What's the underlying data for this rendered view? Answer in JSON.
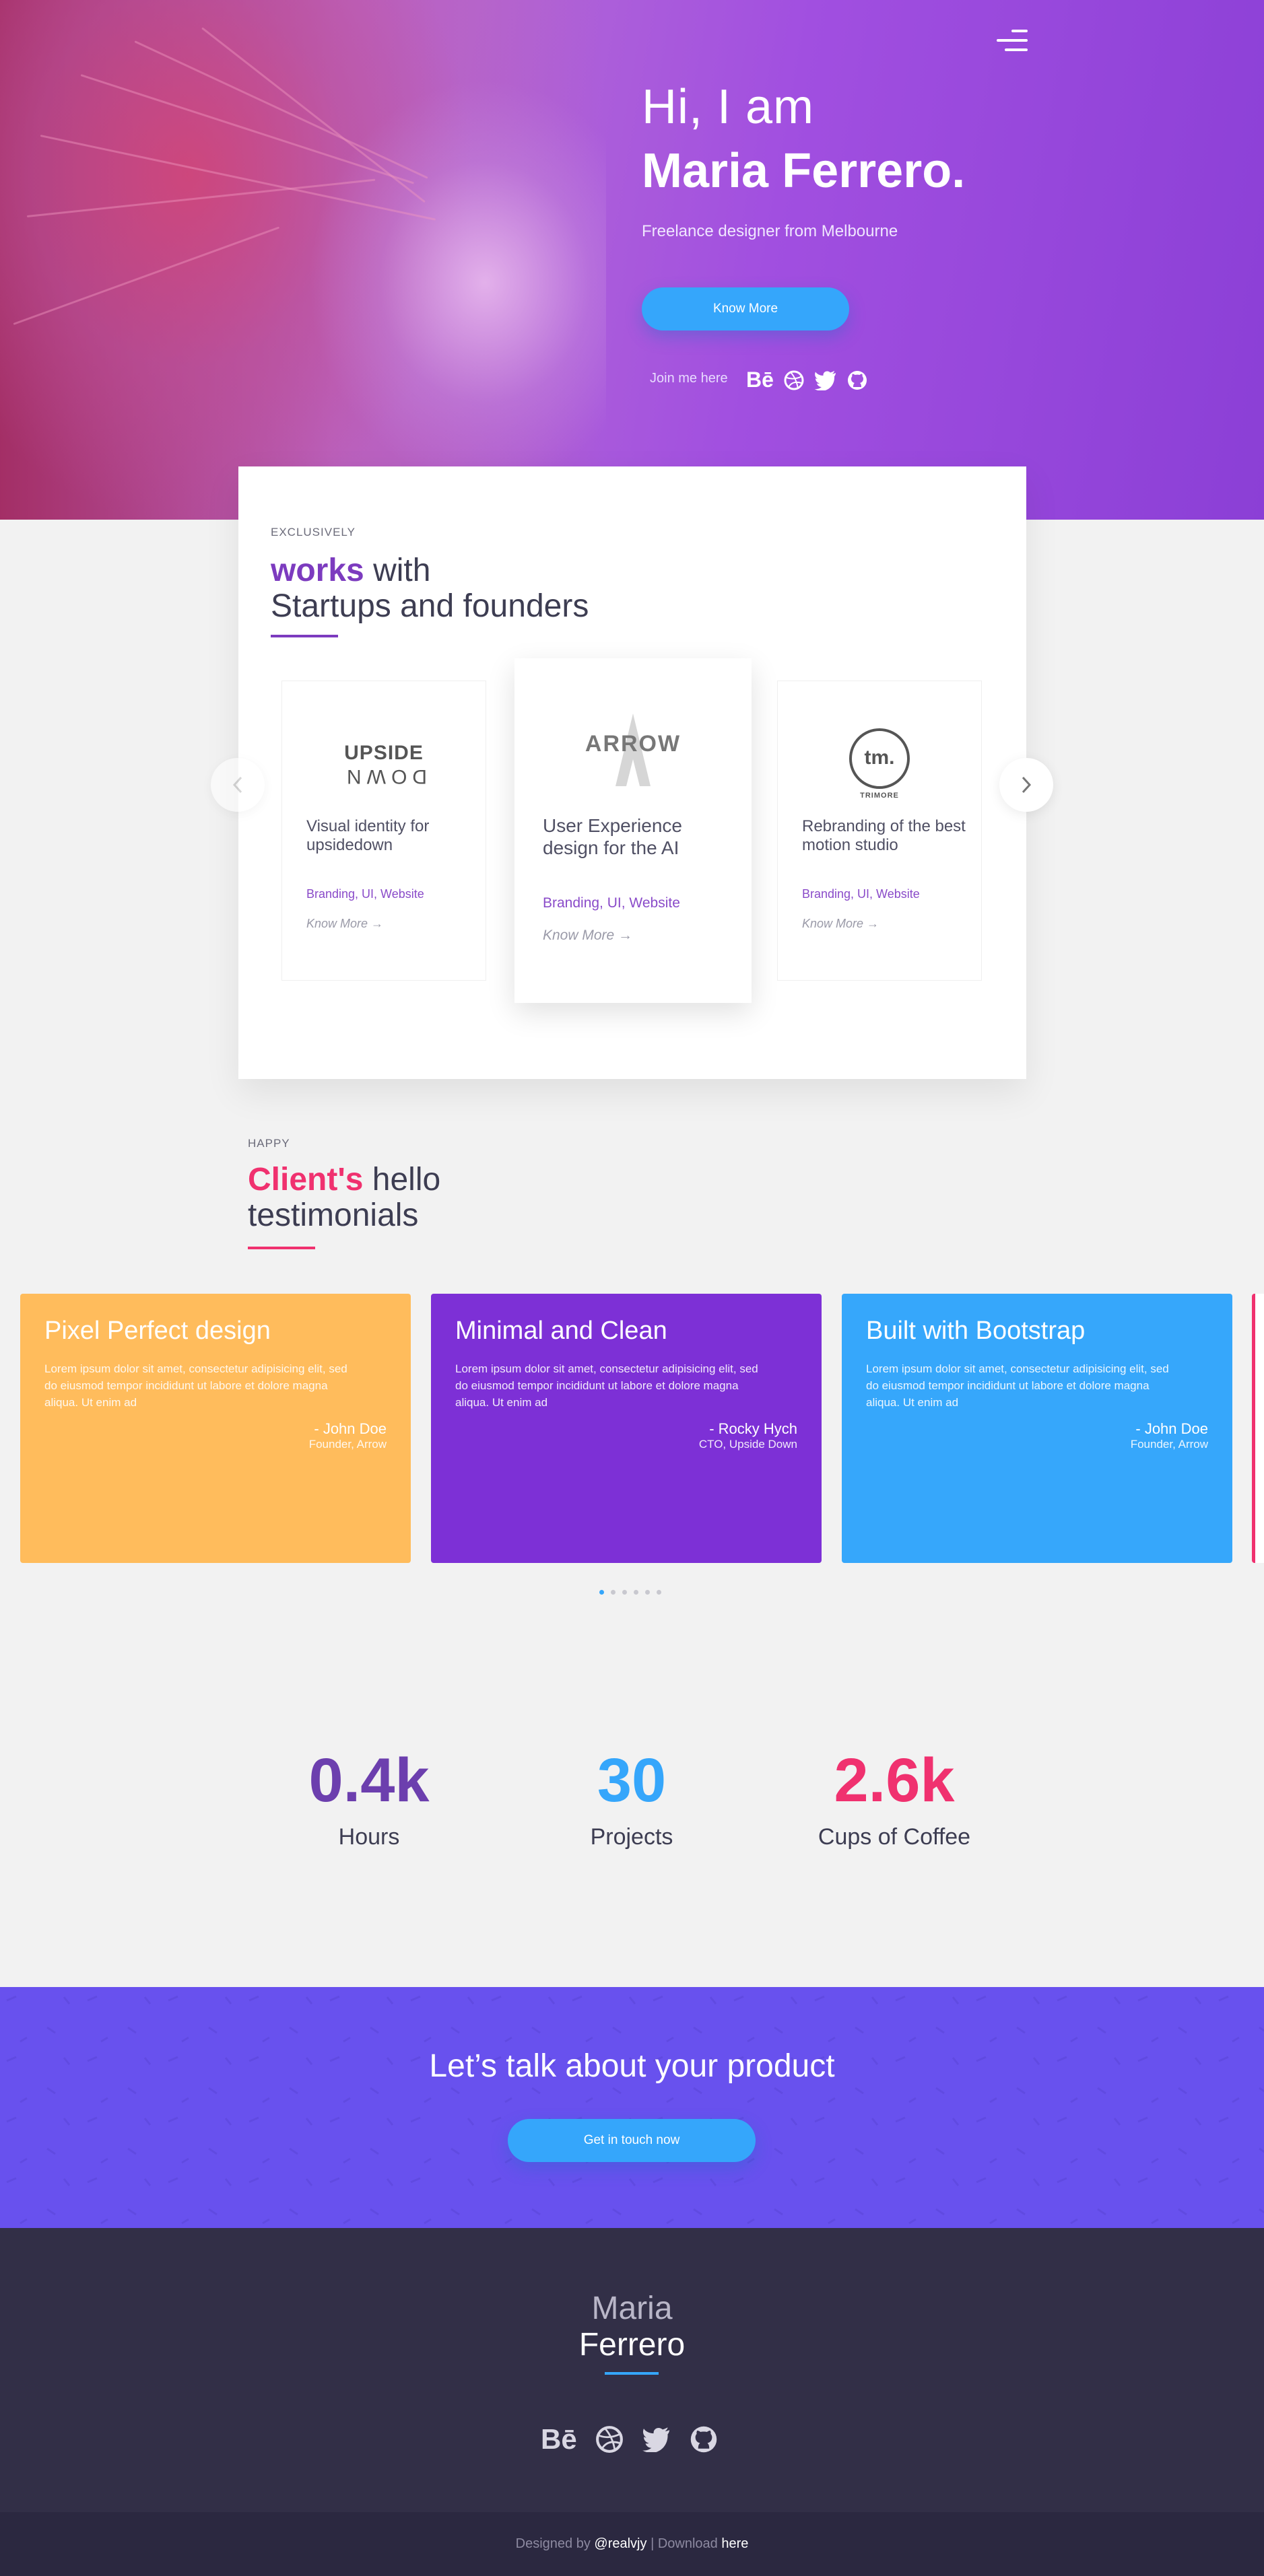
{
  "hero": {
    "greeting": "Hi, I am",
    "name": "Maria Ferrero.",
    "subtitle": "Freelance designer from Melbourne",
    "button_label": "Know More",
    "join_label": "Join me here",
    "menu_icon": "hamburger-menu-icon",
    "socials": [
      "behance-icon",
      "dribbble-icon",
      "twitter-icon",
      "github-icon"
    ]
  },
  "works": {
    "eyebrow": "EXCLUSIVELY",
    "title_bold": "works",
    "title_rest": " with",
    "title_line2": "Startups and founders",
    "accent": "#7c3bbf",
    "projects": [
      {
        "logo_top": "UPSIDE",
        "logo_bottom": "DOWN",
        "title": "Visual identity for upsidedown",
        "tags": "Branding, UI, Website",
        "more": "Know More →"
      },
      {
        "logo_top": "ARROW",
        "title": "User Experience design for the AI",
        "tags": "Branding, UI, Website",
        "more": "Know More →"
      },
      {
        "logo_top": "tm.",
        "logo_bottom": "TRIMORE",
        "title": "Rebranding of the best motion studio",
        "tags": "Branding, UI, Website",
        "more": "Know More →"
      }
    ],
    "prev_icon": "chevron-left-icon",
    "next_icon": "chevron-right-icon"
  },
  "testimonials": {
    "eyebrow": "HAPPY",
    "title_bold": "Client's",
    "title_rest": " hello",
    "title_line2": "testimonials",
    "accent": "#f0316f",
    "items": [
      {
        "title": "Pixel Perfect design",
        "text": "Lorem ipsum dolor sit amet, consectetur adipisicing elit, sed do eiusmod tempor incididunt ut labore et dolore magna aliqua. Ut enim ad",
        "author": "- John Doe",
        "role": "Founder, Arrow",
        "color": "#ffbc5c"
      },
      {
        "title": "Minimal and Clean",
        "text": "Lorem ipsum dolor sit amet, consectetur adipisicing elit, sed do eiusmod tempor incididunt ut labore et dolore magna aliqua. Ut enim ad",
        "author": "- Rocky Hych",
        "role": "CTO, Upside Down",
        "color": "#7d30d6"
      },
      {
        "title": "Built with Bootstrap",
        "text": "Lorem ipsum dolor sit amet, consectetur adipisicing elit, sed do eiusmod tempor incididunt ut labore et dolore magna aliqua. Ut enim ad",
        "author": "- John Doe",
        "role": "Founder, Arrow",
        "color": "#36a7fb"
      }
    ],
    "dots": 6,
    "active_dot": 0
  },
  "stats": [
    {
      "value": "0.4k",
      "label": "Hours",
      "color": "#6c3fae"
    },
    {
      "value": "30",
      "label": "Projects",
      "color": "#35a6fb"
    },
    {
      "value": "2.6k",
      "label": "Cups of Coffee",
      "color": "#f0316f"
    }
  ],
  "cta": {
    "title": "Let’s talk about your product",
    "button_label": "Get in touch now",
    "color": "#6851ee"
  },
  "footer": {
    "name_line1": "Maria",
    "name_line2": "Ferrero",
    "socials": [
      "behance-icon",
      "dribbble-icon",
      "twitter-icon",
      "github-icon"
    ],
    "credit_prefix": "Designed by",
    "credit_author": "@realvjy",
    "credit_sep": "| Download",
    "credit_link": "here"
  }
}
